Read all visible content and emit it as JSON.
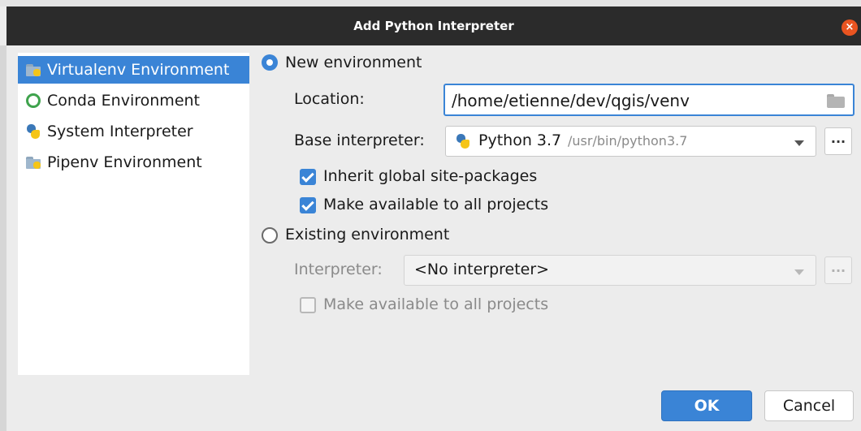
{
  "window": {
    "title": "Add Python Interpreter",
    "close_glyph": "×"
  },
  "sidebar": {
    "items": [
      {
        "label": "Virtualenv Environment",
        "icon": "virtualenv-icon",
        "selected": true
      },
      {
        "label": "Conda Environment",
        "icon": "conda-icon",
        "selected": false
      },
      {
        "label": "System Interpreter",
        "icon": "python-icon",
        "selected": false
      },
      {
        "label": "Pipenv Environment",
        "icon": "pipenv-icon",
        "selected": false
      }
    ]
  },
  "new_env": {
    "radio_label": "New environment",
    "location_label": "Location:",
    "location_value": "/home/etienne/dev/qgis/venv",
    "base_label": "Base interpreter:",
    "base_name": "Python 3.7",
    "base_path": "/usr/bin/python3.7",
    "browse_label": "...",
    "inherit_label": "Inherit global site-packages",
    "make_available_label": "Make available to all projects"
  },
  "existing_env": {
    "radio_label": "Existing environment",
    "interpreter_label": "Interpreter:",
    "interpreter_value": "<No interpreter>",
    "browse_label": "...",
    "make_available_label": "Make available to all projects"
  },
  "buttons": {
    "ok": "OK",
    "cancel": "Cancel"
  },
  "colors": {
    "accent": "#3a84d6",
    "titlebar": "#2b2b2b",
    "close": "#e95420"
  }
}
